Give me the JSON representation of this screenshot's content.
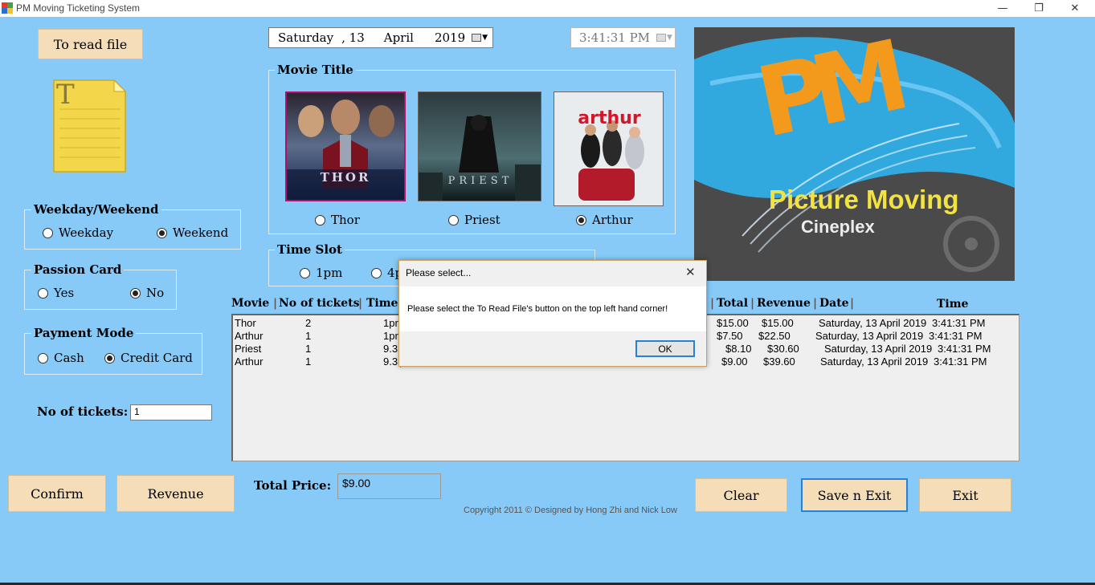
{
  "window": {
    "title": "PM Moving Ticketing System",
    "minimize_glyph": "—",
    "restore_glyph": "❐",
    "close_glyph": "✕"
  },
  "buttons": {
    "read_file": "To read file",
    "confirm": "Confirm",
    "revenue": "Revenue",
    "clear": "Clear",
    "save_exit": "Save n Exit",
    "exit": "Exit"
  },
  "file_icon_letter": "T",
  "date_picker": {
    "day": "Saturday",
    "comma_date": ", 13",
    "month": "April",
    "year": "2019"
  },
  "time_picker": {
    "value": "3:41:31 PM"
  },
  "movie_title": {
    "label": "Movie Title",
    "options": [
      {
        "label": "Thor",
        "selected": false,
        "poster_text": "THOR"
      },
      {
        "label": "Priest",
        "selected": false,
        "poster_text": "PRIEST"
      },
      {
        "label": "Arthur",
        "selected": true,
        "poster_text": "arthur"
      }
    ]
  },
  "logo": {
    "letters": "PM",
    "title": "Picture Moving",
    "subtitle": "Cineplex"
  },
  "weekday_weekend": {
    "label": "Weekday/Weekend",
    "options": [
      {
        "label": "Weekday",
        "selected": false
      },
      {
        "label": "Weekend",
        "selected": true
      }
    ]
  },
  "passion_card": {
    "label": "Passion Card",
    "options": [
      {
        "label": "Yes",
        "selected": false
      },
      {
        "label": "No",
        "selected": true
      }
    ]
  },
  "payment_mode": {
    "label": "Payment Mode",
    "options": [
      {
        "label": "Cash",
        "selected": false
      },
      {
        "label": "Credit Card",
        "selected": true
      }
    ]
  },
  "time_slot": {
    "label": "Time Slot",
    "options": [
      {
        "label": "1pm",
        "selected": false
      },
      {
        "label": "4p",
        "selected": false
      }
    ]
  },
  "tickets": {
    "label": "No of tickets:",
    "value": "1"
  },
  "table": {
    "headers": [
      "Movie",
      "No of tickets",
      "Time",
      "Total",
      "Revenue",
      "Date",
      "Time"
    ],
    "rows": [
      {
        "movie": "Thor",
        "tickets": "2",
        "time": "1pr",
        "total": "$15.00",
        "revenue": "$15.00",
        "date": "Saturday, 13 April 2019",
        "clock": "3:41:31 PM"
      },
      {
        "movie": "Arthur",
        "tickets": "1",
        "time": "1pr",
        "total": "$7.50",
        "revenue": "$22.50",
        "date": "Saturday, 13 April 2019",
        "clock": "3:41:31 PM"
      },
      {
        "movie": "Priest",
        "tickets": "1",
        "time": "9.3(",
        "total": "$8.10",
        "revenue": "$30.60",
        "date": "Saturday, 13 April 2019",
        "clock": "3:41:31 PM"
      },
      {
        "movie": "Arthur",
        "tickets": "1",
        "time": "9.3(",
        "total": "$9.00",
        "revenue": "$39.60",
        "date": "Saturday, 13 April 2019",
        "clock": "3:41:31 PM"
      }
    ]
  },
  "total_price": {
    "label": "Total Price:",
    "value": "$9.00"
  },
  "copyright": "Copyright 2011 © Designed by Hong Zhi and Nick Low",
  "dialog": {
    "title": "Please select...",
    "message": "Please select the To Read File's button on the top left hand corner!",
    "ok": "OK",
    "close_glyph": "✕"
  },
  "colors": {
    "background": "#87c9f7",
    "button": "#f5ddb7",
    "focus": "#2a7fd6"
  }
}
